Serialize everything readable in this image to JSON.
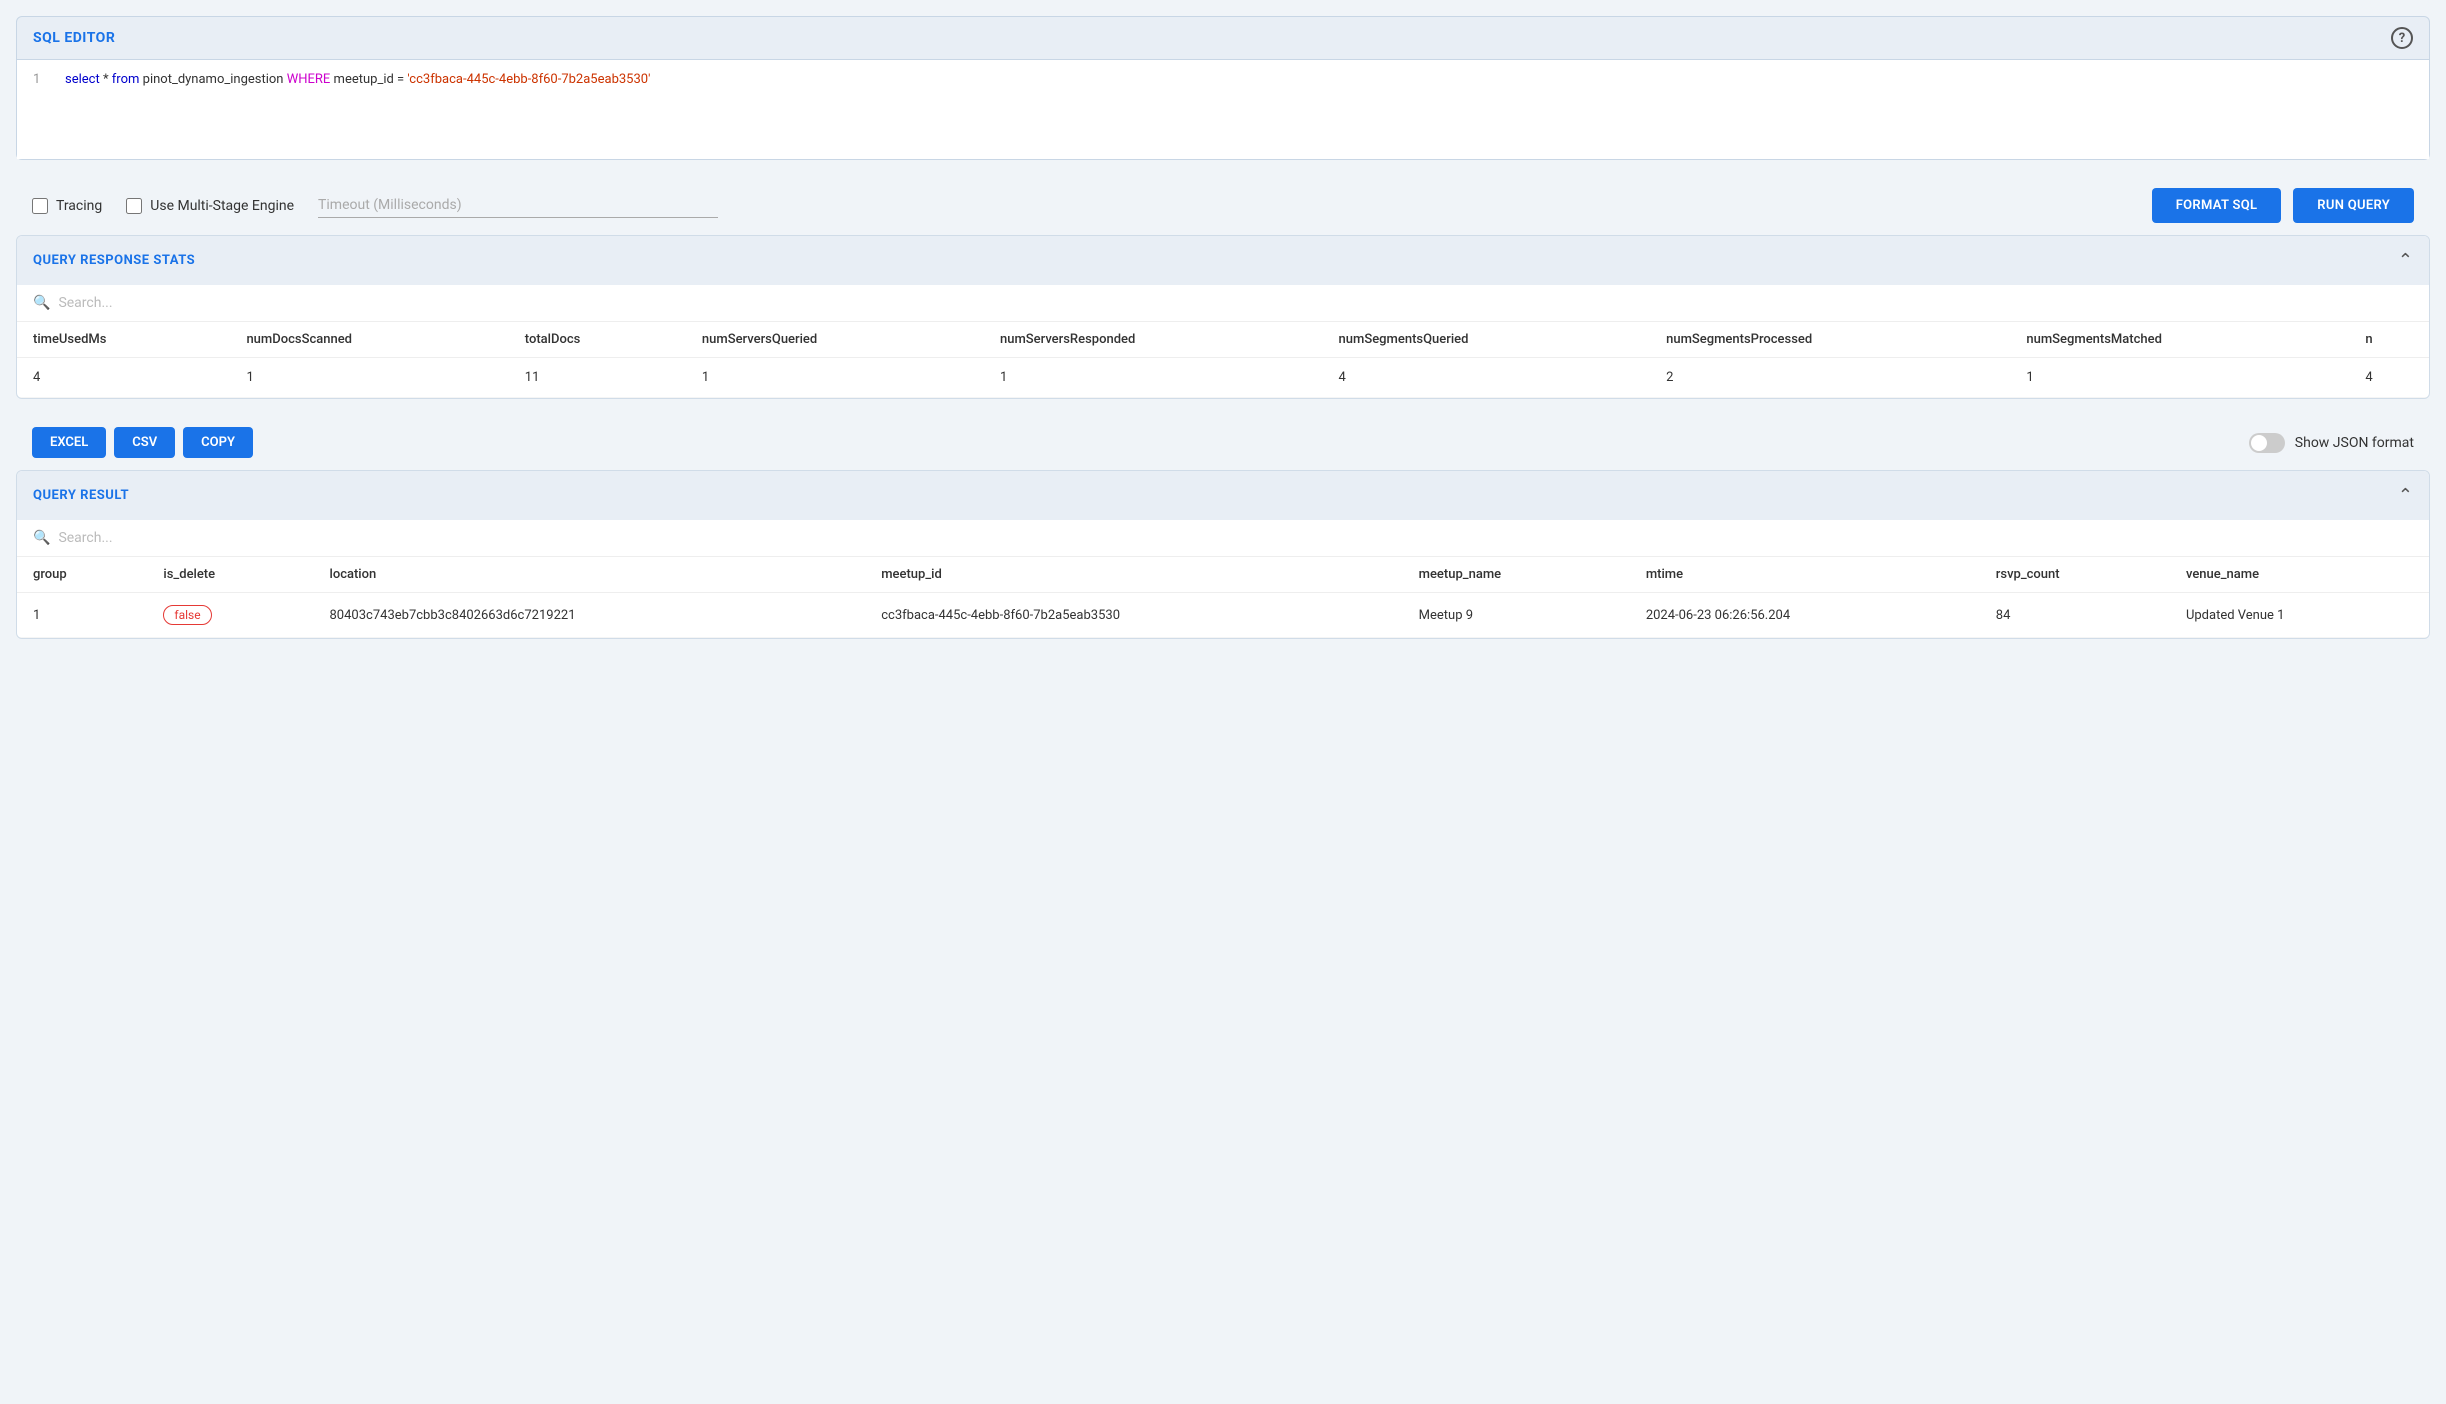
{
  "sqlEditor": {
    "title": "SQL EDITOR",
    "helpLabel": "?",
    "query": {
      "line": 1,
      "selectPart": "select * from pinot_dynamo_ingestion",
      "wherePart": "WHERE",
      "conditionPart": "meetup_id =",
      "stringValue": "'cc3fbaca-445c-4ebb-8f60-7b2a5eab3530'"
    }
  },
  "toolbar": {
    "tracingLabel": "Tracing",
    "multiStageLabel": "Use Multi-Stage Engine",
    "timeoutPlaceholder": "Timeout (Milliseconds)",
    "formatSqlLabel": "FORMAT SQL",
    "runQueryLabel": "RUN QUERY"
  },
  "queryResponseStats": {
    "title": "QUERY RESPONSE STATS",
    "searchPlaceholder": "Search...",
    "columns": [
      "timeUsedMs",
      "numDocsScanned",
      "totalDocs",
      "numServersQueried",
      "numServersResponded",
      "numSegmentsQueried",
      "numSegmentsProcessed",
      "numSegmentsMatched",
      "n"
    ],
    "row": {
      "timeUsedMs": "4",
      "numDocsScanned": "1",
      "totalDocs": "11",
      "numServersQueried": "1",
      "numServersResponded": "1",
      "numSegmentsQueried": "4",
      "numSegmentsProcessed": "2",
      "numSegmentsMatched": "1",
      "extra": "4"
    }
  },
  "actionBar": {
    "excelLabel": "EXCEL",
    "csvLabel": "CSV",
    "copyLabel": "COPY",
    "showJsonLabel": "Show JSON format"
  },
  "queryResult": {
    "title": "QUERY RESULT",
    "searchPlaceholder": "Search...",
    "columns": [
      "group",
      "is_delete",
      "location",
      "meetup_id",
      "meetup_name",
      "mtime",
      "rsvp_count",
      "venue_name"
    ],
    "rows": [
      {
        "group": "1",
        "is_delete": "false",
        "location": "80403c743eb7cbb3c8402663d6c7219221",
        "meetup_id": "cc3fbaca-445c-4ebb-8f60-7b2a5eab3530",
        "meetup_name": "Meetup 9",
        "mtime": "2024-06-23 06:26:56.204",
        "rsvp_count": "84",
        "venue_name": "Updated Venue 1"
      }
    ]
  },
  "colors": {
    "accent": "#1a73e8",
    "headerBg": "#e8eef5",
    "border": "#c8d6e5",
    "falseBadgeColor": "#e53935"
  }
}
